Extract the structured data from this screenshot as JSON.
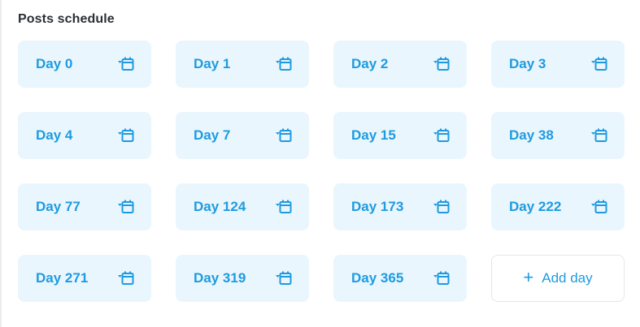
{
  "section": {
    "title": "Posts schedule"
  },
  "days": [
    {
      "label": "Day 0",
      "icon": "calendar-icon"
    },
    {
      "label": "Day 1",
      "icon": "calendar-icon"
    },
    {
      "label": "Day 2",
      "icon": "calendar-icon"
    },
    {
      "label": "Day 3",
      "icon": "calendar-icon"
    },
    {
      "label": "Day 4",
      "icon": "calendar-icon"
    },
    {
      "label": "Day 7",
      "icon": "calendar-icon"
    },
    {
      "label": "Day 15",
      "icon": "calendar-icon"
    },
    {
      "label": "Day 38",
      "icon": "calendar-icon"
    },
    {
      "label": "Day 77",
      "icon": "calendar-icon"
    },
    {
      "label": "Day 124",
      "icon": "calendar-icon"
    },
    {
      "label": "Day 173",
      "icon": "calendar-icon"
    },
    {
      "label": "Day 222",
      "icon": "calendar-icon"
    },
    {
      "label": "Day 271",
      "icon": "calendar-icon"
    },
    {
      "label": "Day 319",
      "icon": "calendar-icon"
    },
    {
      "label": "Day 365",
      "icon": "calendar-icon"
    }
  ],
  "add_day": {
    "icon": "plus-icon",
    "label": "Add day"
  },
  "colors": {
    "accent": "#1e9be0",
    "card_background": "#eaf6fd",
    "title_text": "#2b2f33"
  }
}
